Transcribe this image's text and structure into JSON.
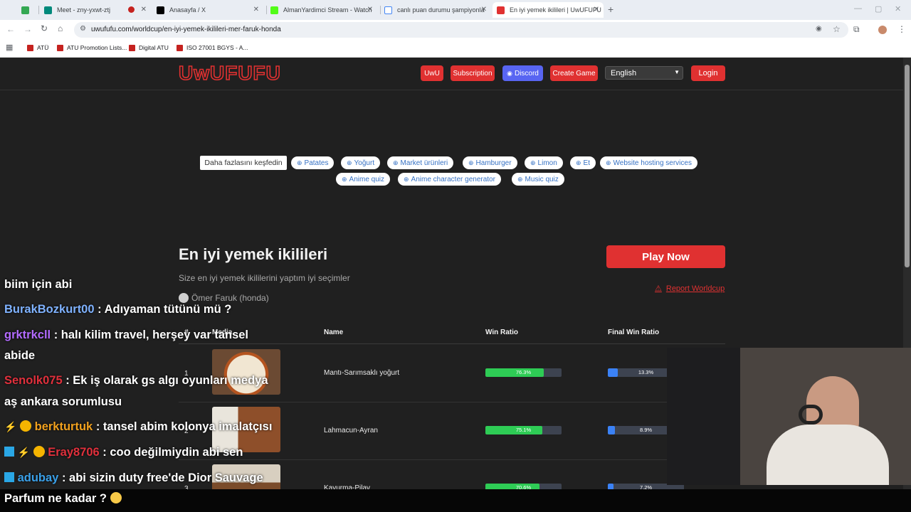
{
  "browser": {
    "tabs": [
      {
        "title": ""
      },
      {
        "title": "Meet - zny-yxwt-ztj"
      },
      {
        "title": ""
      },
      {
        "title": "Anasayfa / X"
      },
      {
        "title": "AlmanYardimci Stream - Watch"
      },
      {
        "title": "canlı puan durumu şampiyonla"
      },
      {
        "title": "En iyi yemek ikilileri | UwUFUFU"
      }
    ],
    "new_tab": "+",
    "url": "uwufufu.com/worldcup/en-iyi-yemek-ikilileri-mer-faruk-honda",
    "bookmarks": [
      "ATÜ",
      "ATU Promotion Lists...",
      "Digital ATU",
      "ISO 27001 BGYS - A..."
    ]
  },
  "site": {
    "logo": "UwUFUFU",
    "nav": {
      "uwu": "UwU",
      "subscription": "Subscription",
      "discord": "Discord",
      "create_game": "Create Game",
      "language": "English",
      "login": "Login"
    },
    "explore_label": "Daha fazlasını keşfedin",
    "chips": [
      "Patates",
      "Yoğurt",
      "Market ürünleri",
      "Hamburger",
      "Limon",
      "Et",
      "Website hosting services",
      "Anime quiz",
      "Anime character generator",
      "Music quiz"
    ],
    "title": "En iyi yemek ikilileri",
    "description": "Size en iyi yemek ikililerini yaptım iyi seçimler",
    "author": "Ömer Faruk (honda)",
    "play_now": "Play Now",
    "report": "Report Worldcup",
    "table": {
      "headers": {
        "rank": "#",
        "media": "Media",
        "name": "Name",
        "win_ratio": "Win Ratio",
        "final_win_ratio": "Final Win Ratio"
      },
      "rows": [
        {
          "rank": "1",
          "name": "Mantı-Sarımsaklı yoğurt",
          "win_ratio": "76.3%",
          "win_value": 0.763,
          "final_ratio": "13.3%",
          "final_value": 0.133
        },
        {
          "rank": "2",
          "name": "Lahmacun-Ayran",
          "win_ratio": "75.1%",
          "win_value": 0.751,
          "final_ratio": "8.9%",
          "final_value": 0.089
        },
        {
          "rank": "3",
          "name": "Kavurma-Pilav",
          "win_ratio": "70.6%",
          "win_value": 0.706,
          "final_ratio": "7.2%",
          "final_value": 0.072
        }
      ]
    }
  },
  "chat": [
    {
      "user": "",
      "text": "biim için abi"
    },
    {
      "user": "BurakBozkurt00",
      "text": " : Adıyaman tütünü mü ?"
    },
    {
      "user": "grktrkcll",
      "text": " : halı kilim travel, herşey var tansel"
    },
    {
      "user": "",
      "text": "abide"
    },
    {
      "user": "Senolk075",
      "text": " : Ek iş olarak gs algı oyunları medya"
    },
    {
      "user": "",
      "text": "aş ankara sorumlusu"
    },
    {
      "user": "berkturtuk",
      "text": " : tansel abim kolonya imalatçısı"
    },
    {
      "user": "Eray8706",
      "text": " : coo değilmiydin abi sen"
    },
    {
      "user": "adubay",
      "text": " : abi sizin duty free'de Dior Sauvage"
    },
    {
      "user": "",
      "text": "Parfum ne kadar ?"
    }
  ],
  "colors": {
    "accent": "#e03131",
    "discord": "#5865f2",
    "win_bar": "#2ecc55",
    "final_bar": "#3b82f6"
  }
}
